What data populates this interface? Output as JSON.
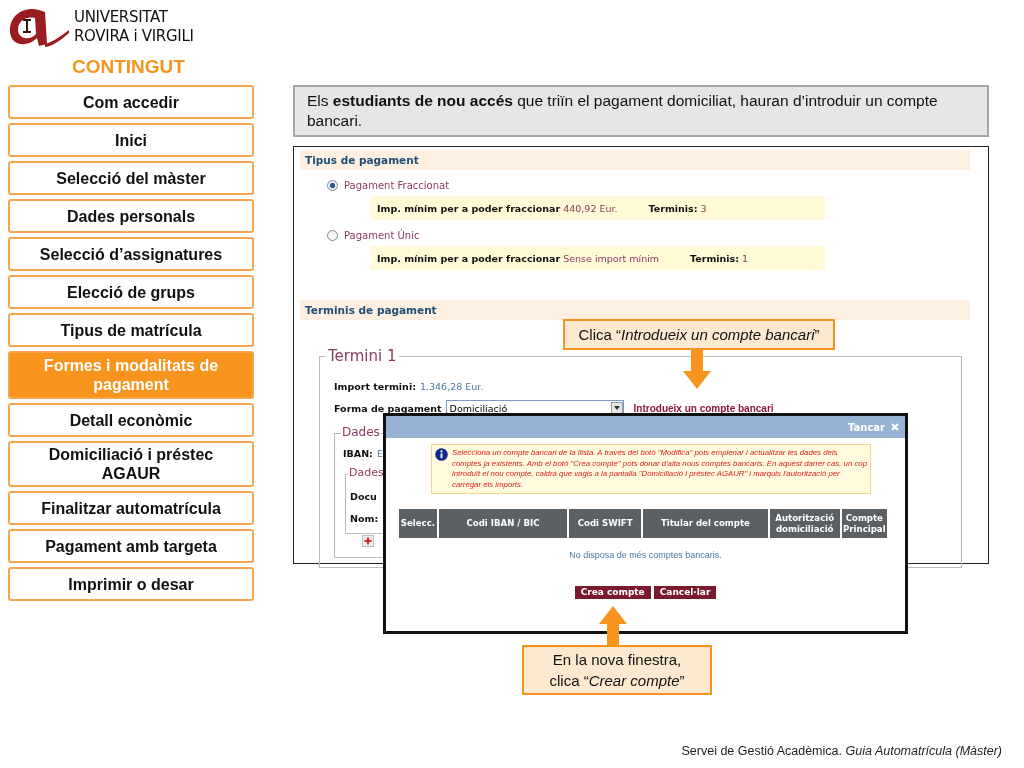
{
  "header": {
    "university_lines": [
      "UNIVERSITAT",
      "ROVIRA i VIRGILI"
    ],
    "section_title": "CONTINGUT"
  },
  "sidebar": {
    "items": [
      {
        "label": "Com accedir",
        "selected": false
      },
      {
        "label": "Inici",
        "selected": false
      },
      {
        "label": "Selecció del màster",
        "selected": false
      },
      {
        "label": "Dades personals",
        "selected": false
      },
      {
        "label": "Selecció d’assignatures",
        "selected": false
      },
      {
        "label": "Elecció de grups",
        "selected": false
      },
      {
        "label": "Tipus de matrícula",
        "selected": false
      },
      {
        "label": "Formes i modalitats de pagament",
        "selected": true
      },
      {
        "label": "Detall econòmic",
        "selected": false
      },
      {
        "label": "Domiciliació i préstec AGAUR",
        "selected": false
      },
      {
        "label": "Finalitzar automatrícula",
        "selected": false
      },
      {
        "label": "Pagament amb targeta",
        "selected": false
      },
      {
        "label": "Imprimir o desar",
        "selected": false
      }
    ]
  },
  "intro": "Els **estudiants de nou accés** que triïn el pagament domiciliat, hauran d’introduir un compte bancari.",
  "screenshot": {
    "payment_type": {
      "title": "Tipus de pagament",
      "options": [
        {
          "label": "Pagament Fraccionat",
          "selected": true,
          "min_label": "Imp. mínim per a poder fraccionar",
          "min_value": "440,92 Eur.",
          "terms_label": "Terminis:",
          "terms_value": "3"
        },
        {
          "label": "Pagament Únic",
          "selected": false,
          "min_label": "Imp. mínim per a poder fraccionar",
          "min_value": "Sense import mínim",
          "terms_label": "Terminis:",
          "terms_value": "1"
        }
      ]
    },
    "terms": {
      "title": "Terminis de pagament",
      "legend": "Termini 1",
      "import_label": "Import termini:",
      "import_value": "1.346,28 Eur.",
      "method_label": "Forma de pagament",
      "method_value": "Domiciliació",
      "link": "Introdueix un compte bancari",
      "bank_legend": "Dades",
      "iban_label": "IBAN:",
      "iban_value": "E",
      "holder_legend": "Dades",
      "document_label": "Docu",
      "name_label": "Nom:"
    }
  },
  "dialog": {
    "close": "Tancar",
    "message": "Selecciona un compte bancari de la llista. A través del botó \"Modifica\" pots emplenar i actualitzar les dades dels comptes ja existents. Amb el botó \"Crea compte\" pots donar d'alta nous comptes bancaris. En aquest darrer cas, un cop introduït el nou compte, caldrà que vagis a la pantalla \"Domiciliació i préstec AGAUR\" i marquis l'autorització per carregar els imports.",
    "columns": [
      "Selecc.",
      "Codi IBAN / BIC",
      "Codi SWIFT",
      "Titular del compte",
      "Autorització domiciliació",
      "Compte Principal"
    ],
    "empty": "No disposa de més comptes bancaris.",
    "buttons": [
      "Crea compte",
      "Cancel·lar"
    ]
  },
  "callouts": [
    "Clica “*Introdueix un compte bancari*”",
    "En la nova finestra, clica “*Crear compte*”"
  ],
  "footer": "Servei de Gestió Acadèmica. *Guia Automatrícula (Màster)*"
}
